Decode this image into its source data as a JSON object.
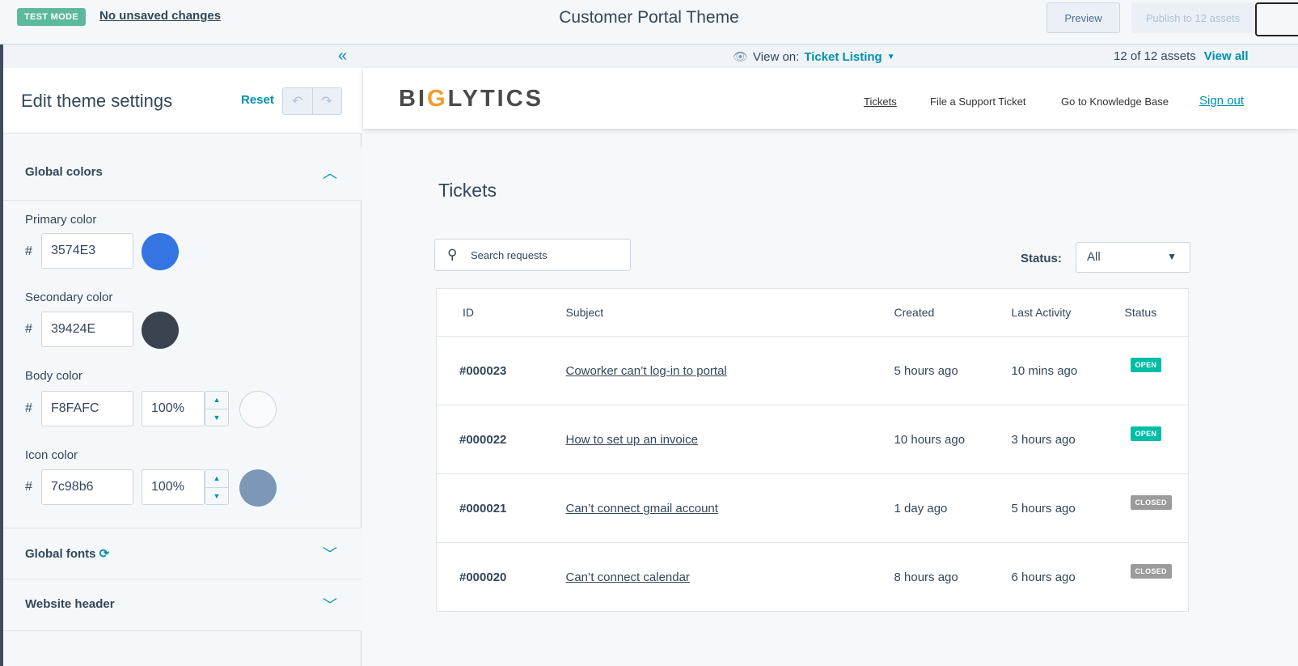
{
  "topbar": {
    "test_mode": "TEST MODE",
    "unsaved": "No unsaved changes",
    "title": "Customer Portal Theme",
    "preview": "Preview",
    "publish": "Publish to 12 assets"
  },
  "subbar": {
    "view_on_label": "View on:",
    "view_on_value": "Ticket Listing",
    "assets_count": "12 of 12 assets",
    "view_all": "View all"
  },
  "left": {
    "title": "Edit theme settings",
    "reset": "Reset",
    "sections": {
      "global_colors": "Global colors",
      "global_fonts": "Global fonts",
      "website_header": "Website header"
    },
    "colors": [
      {
        "label": "Primary color",
        "hex": "3574E3",
        "swatch": "#3574e3"
      },
      {
        "label": "Secondary color",
        "hex": "39424E",
        "swatch": "#39424e"
      },
      {
        "label": "Body color",
        "hex": "F8FAFC",
        "opacity": "100%",
        "swatch": "#f8fafc"
      },
      {
        "label": "Icon color",
        "hex": "7c98b6",
        "opacity": "100%",
        "swatch": "#7c98b6"
      }
    ]
  },
  "portal": {
    "logo_a": "BI",
    "logo_g": "G",
    "logo_b": "LYTICS",
    "nav": [
      "Tickets",
      "File a Support Ticket",
      "Go to Knowledge Base"
    ],
    "signout": "Sign out",
    "page_title": "Tickets",
    "search_placeholder": "Search requests",
    "status_label": "Status:",
    "status_value": "All",
    "columns": [
      "ID",
      "Subject",
      "Created",
      "Last Activity",
      "Status"
    ],
    "rows": [
      {
        "id": "#000023",
        "subject": "Coworker can’t log-in to portal",
        "created": "5 hours ago",
        "last": "10 mins ago",
        "status": "OPEN",
        "color": "#00bda5"
      },
      {
        "id": "#000022",
        "subject": "How to set up an invoice",
        "created": "10 hours ago",
        "last": "3 hours ago",
        "status": "OPEN",
        "color": "#00bda5"
      },
      {
        "id": "#000021",
        "subject": "Can’t connect gmail account",
        "created": "1 day ago",
        "last": "5 hours ago",
        "status": "CLOSED",
        "color": "#9b9b9b"
      },
      {
        "id": "#000020",
        "subject": "Can’t connect calendar",
        "created": "8 hours ago",
        "last": "6 hours ago",
        "status": "CLOSED",
        "color": "#9b9b9b"
      }
    ]
  }
}
